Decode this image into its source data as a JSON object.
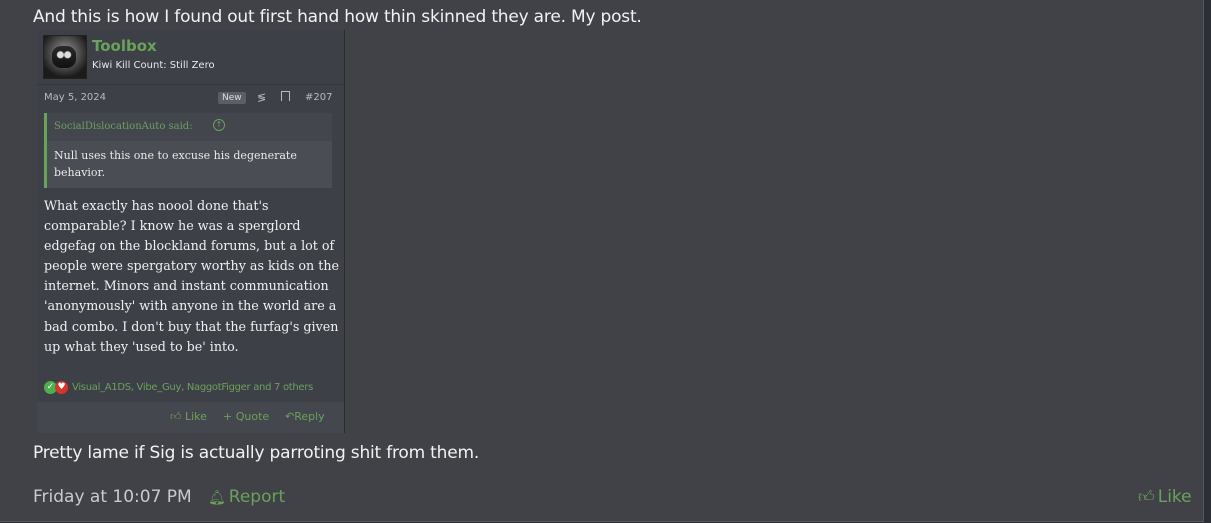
{
  "post": {
    "intro_text": "And this is how I found out first hand how thin skinned they are. My post.",
    "outro_text": "Pretty lame if Sig is actually parroting shit from them.",
    "timestamp": "Friday at 10:07 PM",
    "report_label": "Report",
    "like_label": "Like",
    "accent_color": "#6aa15b"
  },
  "embedded": {
    "username": "Toolbox",
    "user_title": "Kiwi Kill Count: Still Zero",
    "date": "May 5, 2024",
    "new_badge": "New",
    "post_number": "#207",
    "quote_author": "SocialDislocationAuto said:",
    "quote_text": "Null uses this one to excuse his degenerate behavior.",
    "body": "What exactly has noool done that's comparable? I know he was a sperglord edgefag on the blockland forums, but a lot of people were spergatory worthy as kids on the internet. Minors and instant communication 'anonymously' with anyone in the world are a bad combo. I don't buy that the furfag's given up what they 'used to be' into.",
    "reactions_text": "Visual_A1DS, Vibe_Guy, NaggotFigger and 7 others",
    "actions": {
      "like": "Like",
      "quote": "Quote",
      "reply": "Reply"
    }
  }
}
